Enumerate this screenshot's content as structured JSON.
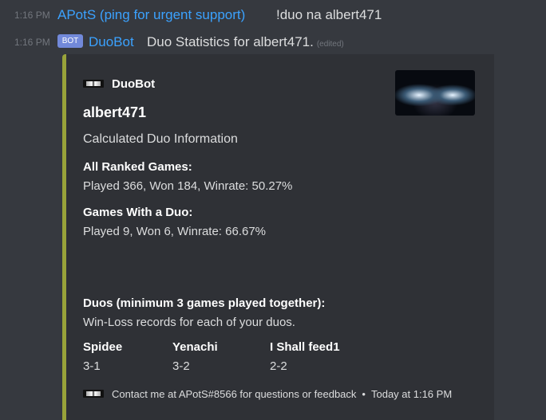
{
  "messages": [
    {
      "time": "1:16 PM",
      "author": "APotS (ping for urgent support)",
      "text": "!duo na albert471"
    },
    {
      "time": "1:16 PM",
      "bot_tag": "BOT",
      "author": "DuoBot",
      "text": "Duo Statistics for albert471.",
      "edited": "(edited)"
    }
  ],
  "embed": {
    "accent_color": "#99a33a",
    "author": "DuoBot",
    "author_icon": "duobot-logo-icon",
    "thumbnail": "thumbnail-image",
    "title": "albert471",
    "description": "Calculated Duo Information",
    "fields": [
      {
        "name": "All Ranked Games:",
        "value": "Played 366, Won 184, Winrate: 50.27%"
      },
      {
        "name": "Games With a Duo:",
        "value": "Played 9, Won 6, Winrate: 66.67%"
      },
      {
        "name": "Duos (minimum 3 games played together):",
        "value": "Win-Loss records for each of your duos."
      }
    ],
    "duos": [
      {
        "name": "Spidee",
        "record": "3-1"
      },
      {
        "name": "Yenachi",
        "record": "3-2"
      },
      {
        "name": "I Shall feed1",
        "record": "2-2"
      }
    ],
    "footer": {
      "text": "Contact me at APotS#8566 for questions or feedback",
      "separator": "•",
      "timestamp": "Today at 1:16 PM"
    }
  }
}
